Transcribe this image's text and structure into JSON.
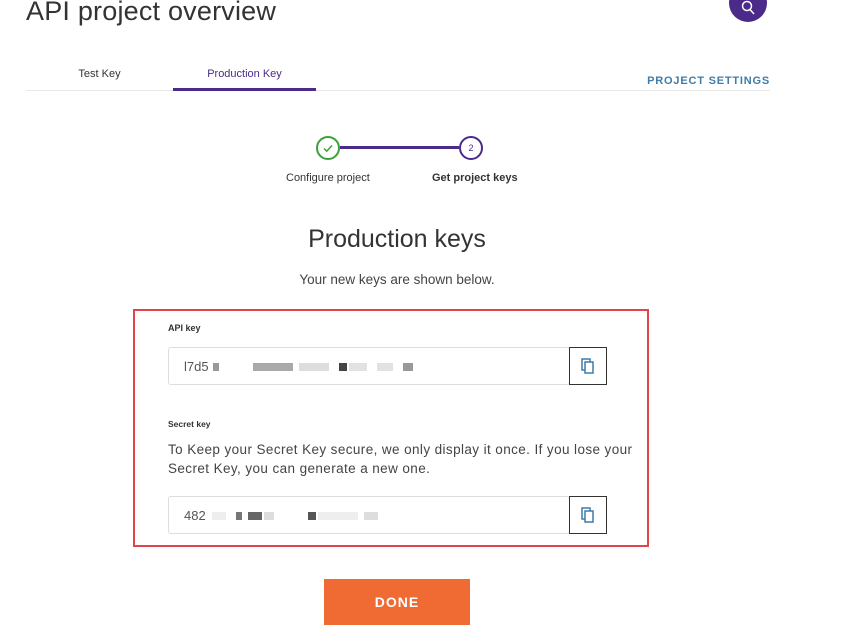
{
  "header": {
    "title": "API project overview",
    "search_icon": "search-icon"
  },
  "tabs": [
    {
      "label": "Test Key",
      "active": false
    },
    {
      "label": "Production Key",
      "active": true
    }
  ],
  "project_settings_label": "PROJECT SETTINGS",
  "stepper": {
    "steps": [
      {
        "label": "Configure project",
        "status": "complete"
      },
      {
        "label": "Get project keys",
        "number": "2",
        "status": "active"
      }
    ]
  },
  "main": {
    "title": "Production keys",
    "subtitle": "Your new keys are shown below."
  },
  "keys": {
    "api_label": "API key",
    "api_value": "l7d5",
    "secret_label": "Secret key",
    "secret_note": "To Keep your Secret Key secure, we only display it once. If you lose your Secret Key, you can generate a new one.",
    "secret_value": "482"
  },
  "done_label": "DONE",
  "colors": {
    "accent": "#4b2a8a",
    "success": "#3aa03a",
    "link": "#3f7ca8",
    "highlight_border": "#e0454d",
    "done_button": "#ef6b33"
  }
}
